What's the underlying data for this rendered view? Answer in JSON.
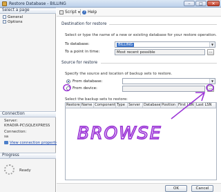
{
  "window": {
    "title": "Restore Database - BILLING"
  },
  "left": {
    "select_page": {
      "heading": "Select a page",
      "items": [
        {
          "label": "General"
        },
        {
          "label": "Options"
        }
      ]
    },
    "connection": {
      "heading": "Connection",
      "server_label": "Server:",
      "server_value": "KHADIR-PC\\SQLEXPRESS",
      "connection_label": "Connection:",
      "connection_value": "sa",
      "link": "View connection properties"
    },
    "progress": {
      "heading": "Progress",
      "status": "Ready"
    }
  },
  "toolbar": {
    "script_label": "Script",
    "help_label": "Help"
  },
  "destination": {
    "heading": "Destination for restore",
    "description": "Select or type the name of a new or existing database for your restore operation.",
    "to_database_label": "To database:",
    "to_database_value": "BILLING",
    "point_in_time_label": "To a point in time:",
    "point_in_time_value": "Most recent possible",
    "browse_button": "..."
  },
  "source": {
    "heading": "Source for restore",
    "description": "Specify the source and location of backup sets to restore.",
    "from_database_label": "From database:",
    "from_database_value": "",
    "from_device_label": "From device:",
    "from_device_button": "...",
    "selected_option": "from_database"
  },
  "backup_grid": {
    "caption": "Select the backup sets to restore:",
    "columns": [
      "Restore",
      "Name",
      "Component",
      "Type",
      "Server",
      "Database",
      "Position",
      "First LSN",
      "Last LSN"
    ]
  },
  "buttons": {
    "ok": "OK",
    "cancel": "Cancel"
  },
  "annotation": {
    "text": "BROWSE",
    "color": "#9b34d6"
  }
}
